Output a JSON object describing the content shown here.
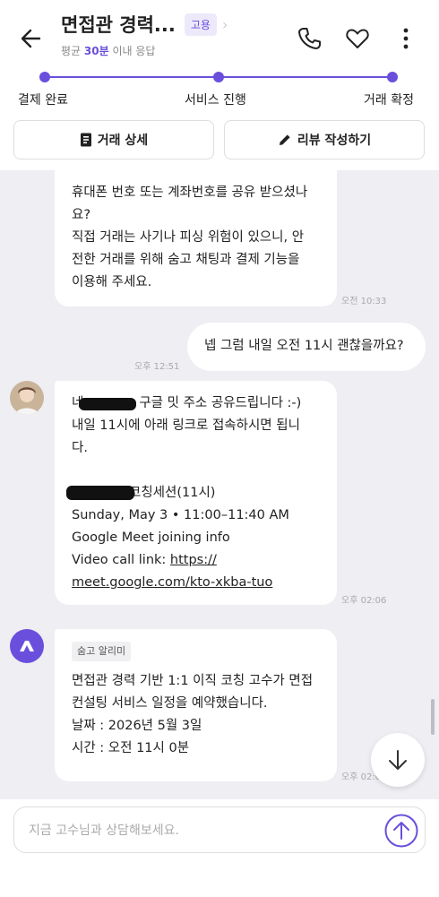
{
  "header": {
    "title": "면접관 경력...",
    "badge": "고용",
    "subtitle_prefix": "평균 ",
    "subtitle_highlight": "30분",
    "subtitle_suffix": " 이내 응답"
  },
  "progress": {
    "steps": [
      "결제 완료",
      "서비스 진행",
      "거래 확정"
    ]
  },
  "actions": {
    "details": "거래 상세",
    "review": "리뷰 작성하기"
  },
  "messages": {
    "m1": {
      "lines": [
        "휴대폰 번호 또는 계좌번호를 공유 받으셨나",
        "요?",
        "직접 거래는 사기나 피싱 위험이 있으니, 안",
        "전한 거래를 위해 숨고 채팅과 결제 기능을",
        "이용해 주세요."
      ],
      "time": "오전 10:33"
    },
    "m2": {
      "text": "넵 그럼 내일 오전 11시 괜찮을까요?",
      "time": "오후 12:51"
    },
    "m3": {
      "line1_prefix": "네",
      "line1_suffix": "구글 밋 주소 공유드립니다 :-)",
      "line2": "내일 11시에 아래 링크로 접속하시면 됩니",
      "line3": "다.",
      "session_suffix": "코칭세션(11시)",
      "date_line": "Sunday, May 3  •  11:00–11:40 AM",
      "meet_line": "Google Meet joining info",
      "link_label": "Video call link: ",
      "link_part1": "https://",
      "link_part2": "meet.google.com/kto-xkba-tuo",
      "time": "오후 02:06"
    },
    "m4": {
      "tag": "숨고 알리미",
      "line1": "면접관 경력 기반 1:1 이직 코칭 고수가 면접",
      "line2": "컨설팅 서비스 일정을 예약했습니다.",
      "line3": "날짜 : 2026년 5월 3일",
      "line4": "시간 : 오전 11시 0분",
      "time": "오후 02:0"
    }
  },
  "composer": {
    "placeholder": "지금 고수님과 상담해보세요."
  },
  "colors": {
    "accent": "#6a4fdc",
    "chat_bg": "#eeeef3"
  }
}
